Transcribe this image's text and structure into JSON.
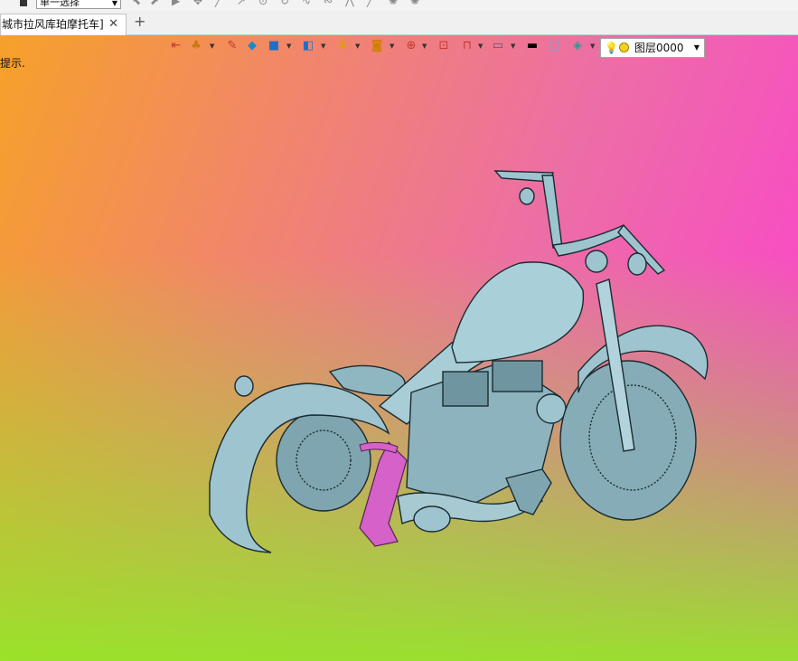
{
  "selection": {
    "mode": "单一选择"
  },
  "tabs": [
    {
      "label": "城市拉风库珀摩托车]",
      "close": "✕"
    }
  ],
  "add_tab": "+",
  "viewport": {
    "hint": "提示."
  },
  "layer": {
    "current": "图层0000"
  },
  "icons": {
    "tab_close": "close-icon",
    "add": "plus-icon",
    "layer_bulb": "lightbulb-icon",
    "layer_color": "yellow-circle-icon"
  },
  "colors": {
    "model": "#9ec5cf",
    "highlight": "#d462c8",
    "bg_top_left": "#f6a12a",
    "bg_top_right": "#ff3cd2",
    "bg_bottom": "#96e628"
  }
}
